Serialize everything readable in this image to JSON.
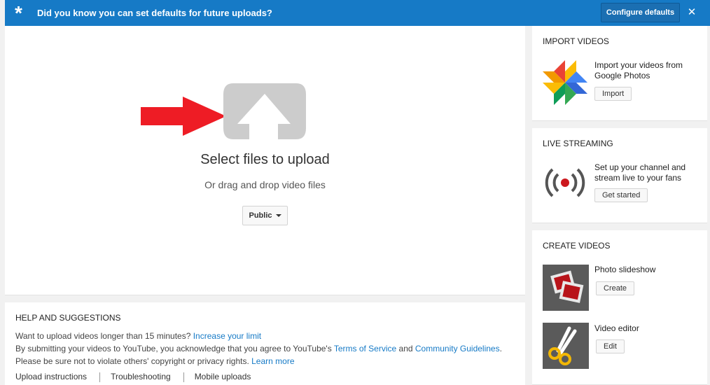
{
  "banner": {
    "message": "Did you know you can set defaults for future uploads?",
    "configure_label": "Configure defaults",
    "close_symbol": "✕",
    "star_symbol": "*",
    "background_color": "#167ac6"
  },
  "upload": {
    "title": "Select files to upload",
    "subtitle": "Or drag and drop video files",
    "privacy_value": "Public",
    "arrow_color": "#ee1c25"
  },
  "help": {
    "title": "HELP AND SUGGESTIONS",
    "line1_text": "Want to upload videos longer than 15 minutes? ",
    "line1_link": "Increase your limit",
    "line2_text": "By submitting your videos to YouTube, you acknowledge that you agree to YouTube's ",
    "line2_link1": "Terms of Service",
    "line2_and": " and ",
    "line2_link2": "Community Guidelines",
    "line2_end": ".",
    "line3_text": "Please be sure not to violate others' copyright or privacy rights. ",
    "line3_link": "Learn more",
    "links": [
      "Upload instructions",
      "Troubleshooting",
      "Mobile uploads"
    ]
  },
  "sidebar": {
    "import": {
      "title": "IMPORT VIDEOS",
      "desc_line1": "Import your videos from",
      "desc_line2": "Google Photos",
      "button": "Import",
      "icon": "google-photos-icon"
    },
    "live": {
      "title": "LIVE STREAMING",
      "desc_line1": "Set up your channel and",
      "desc_line2": "stream live to your fans",
      "button": "Get started",
      "icon": "live-broadcast-icon"
    },
    "create": {
      "title": "CREATE VIDEOS",
      "slideshow_label": "Photo slideshow",
      "slideshow_button": "Create",
      "editor_label": "Video editor",
      "editor_button": "Edit"
    }
  }
}
